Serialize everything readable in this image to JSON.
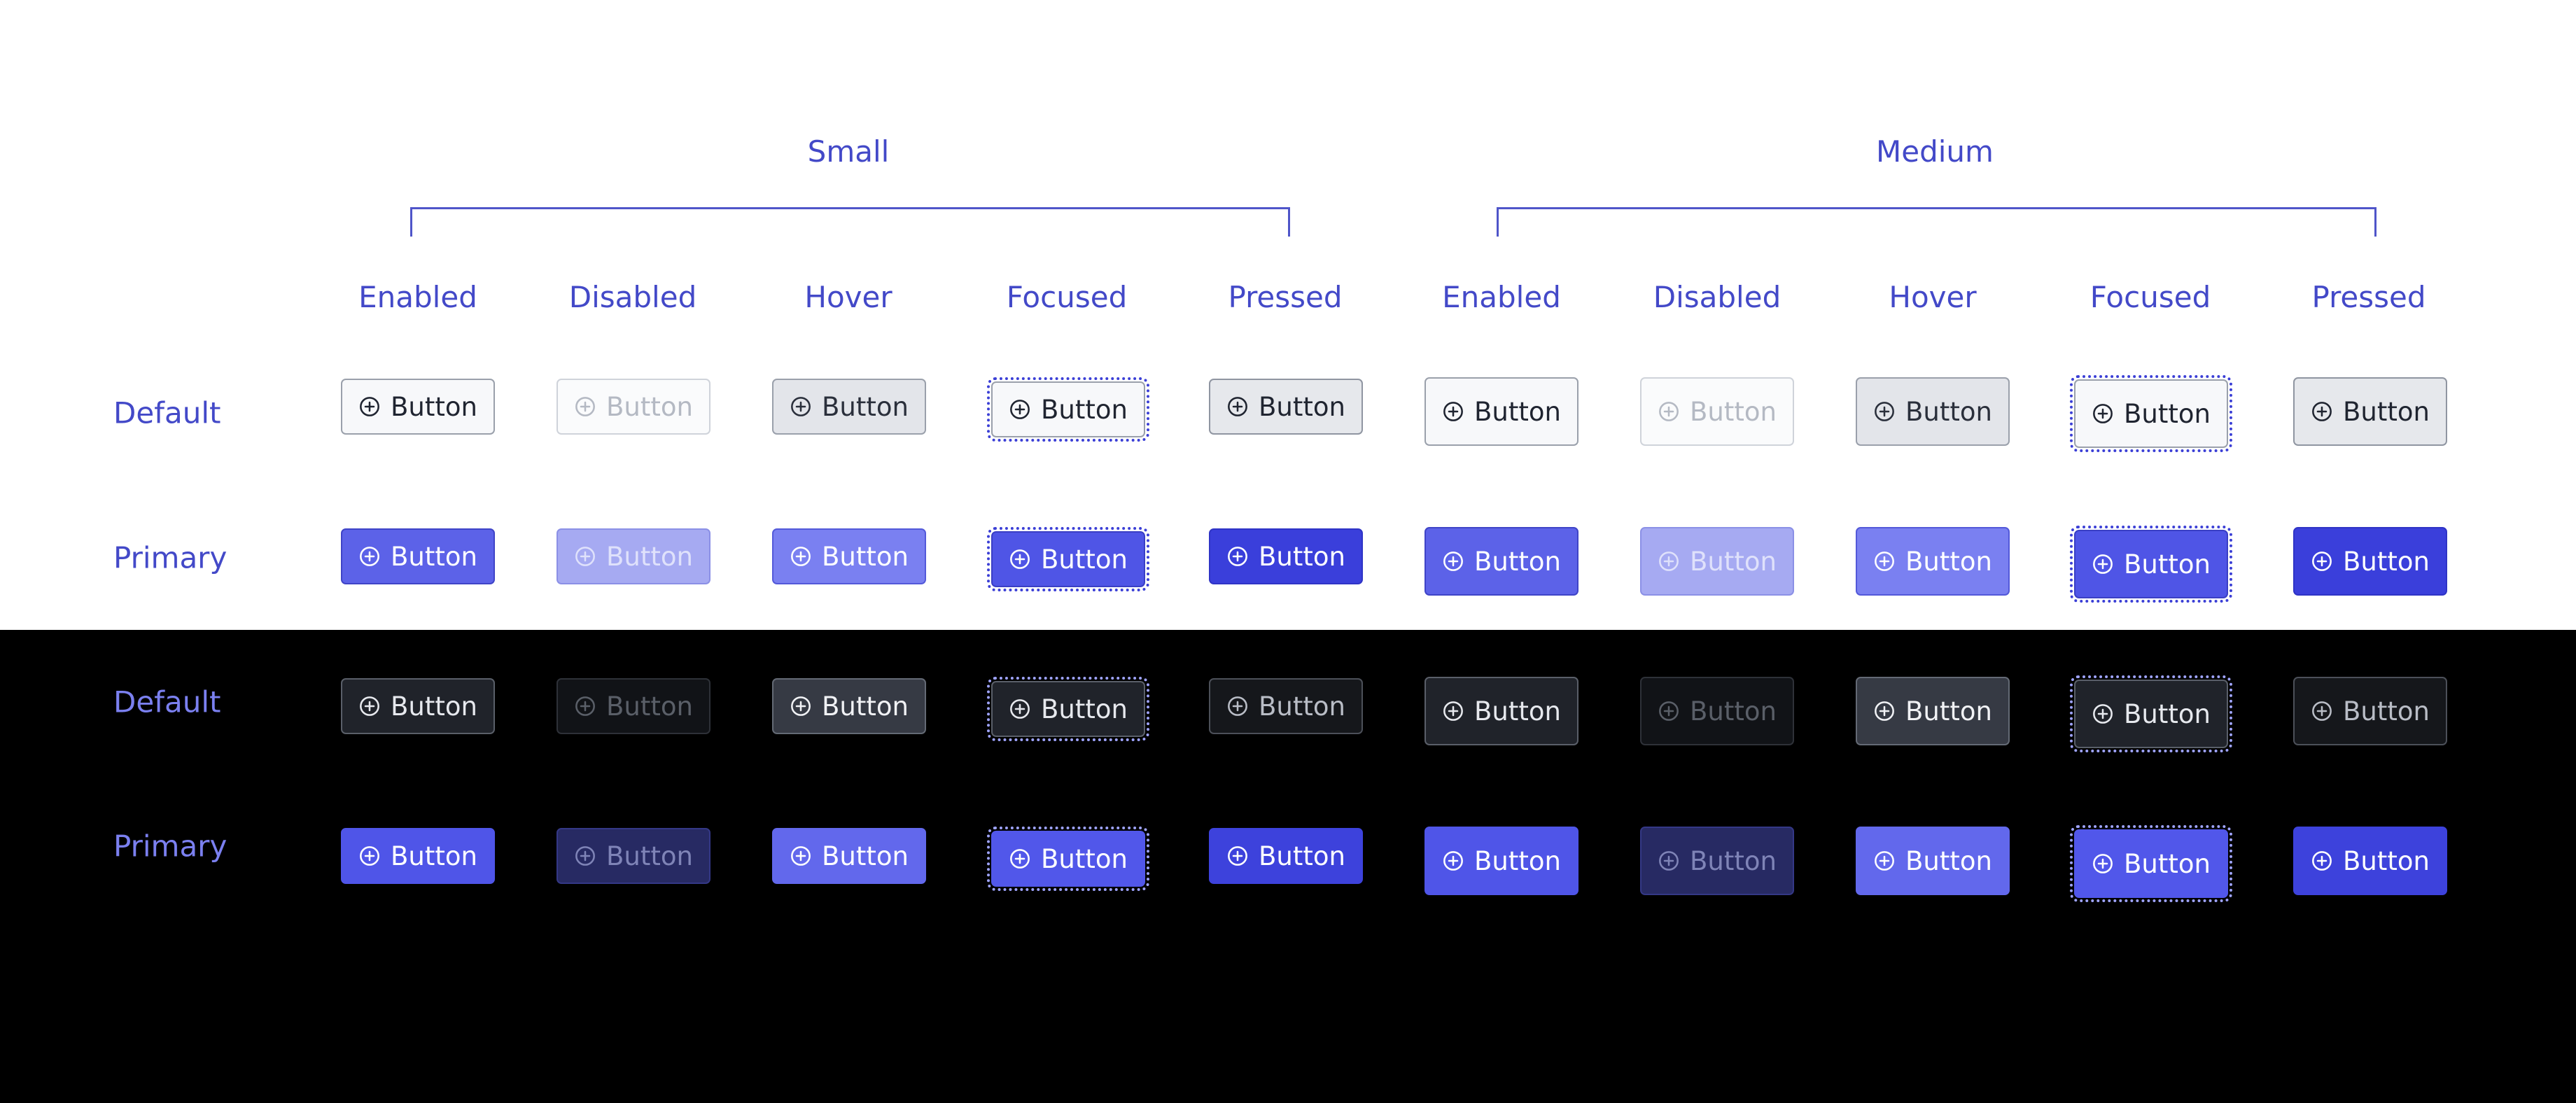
{
  "colors": {
    "accent": "#4349c8",
    "dark_label": "#7b80f0",
    "focus_ring": "#3b3fd6",
    "background_light": "#ffffff",
    "background_dark": "#000000"
  },
  "groups": {
    "small": {
      "label": "Small"
    },
    "medium": {
      "label": "Medium"
    }
  },
  "columns": {
    "small": [
      "Enabled",
      "Disabled",
      "Hover",
      "Focused",
      "Pressed"
    ],
    "medium": [
      "Enabled",
      "Disabled",
      "Hover",
      "Focused",
      "Pressed"
    ]
  },
  "rows": {
    "light_default": "Default",
    "light_primary": "Primary",
    "dark_default": "Default",
    "dark_primary": "Primary"
  },
  "button": {
    "label": "Button",
    "icon": "plus-circle-icon"
  }
}
